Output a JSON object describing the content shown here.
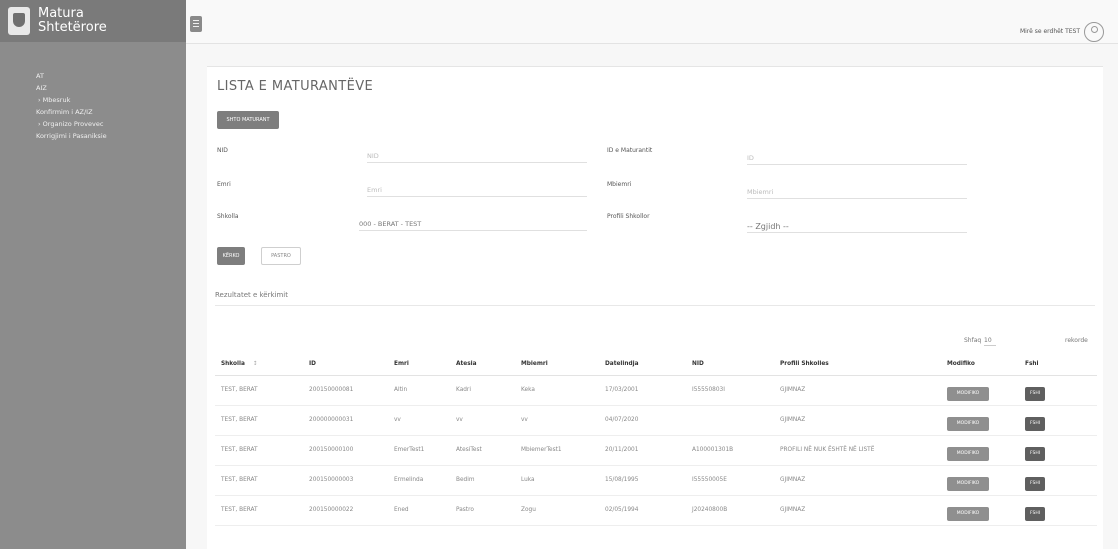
{
  "app": {
    "brand_line1": "Matura",
    "brand_line2": "Shtetërore"
  },
  "sidebar": {
    "items": [
      {
        "label": "AT"
      },
      {
        "label": "AIZ"
      },
      {
        "label": "› Mbesruk"
      },
      {
        "label": "Konfirmim i AZ/IZ"
      },
      {
        "label": "› Organizo Provevec"
      },
      {
        "label": "Korrigjimi i Pasaniksie"
      }
    ]
  },
  "topbar": {
    "welcome": "Mirë se erdhët TEST"
  },
  "page": {
    "title": "LISTA E MATURANTËVE",
    "add_button": "SHTO MATURANT"
  },
  "form": {
    "nid_label": "NID",
    "nid_placeholder": "NID",
    "id_label": "ID e Maturantit",
    "id_placeholder": "ID",
    "emri_label": "Emri",
    "emri_placeholder": "Emri",
    "mbiemri_label": "Mbiemri",
    "mbiemri_placeholder": "Mbiemri",
    "shkolla_label": "Shkolla",
    "shkolla_value": "000 - BERAT - TEST",
    "profili_label": "Profili Shkollor",
    "profili_value": "-- Zgjidh --",
    "search_button": "KËRKO",
    "clear_button": "PASTRO"
  },
  "results": {
    "title": "Rezultatet e kërkimit",
    "show_label": "Shfaq",
    "show_value": "10",
    "records_label": "rekorde",
    "columns": [
      "Shkolla",
      "ID",
      "Emri",
      "Atesia",
      "Mbiemri",
      "Datelindja",
      "NID",
      "Profili Shkolles",
      "Modifiko",
      "Fshi"
    ],
    "modify_label": "MODIFIKO",
    "delete_label": "FSHI",
    "rows": [
      {
        "shkolla": "TEST, BERAT",
        "id": "200150000081",
        "emri": "Altin",
        "atesia": "Kadri",
        "mbiemri": "Keka",
        "datelindja": "17/03/2001",
        "nid": "I55550803I",
        "profili": "GJIMNAZ"
      },
      {
        "shkolla": "TEST, BERAT",
        "id": "200000000031",
        "emri": "vv",
        "atesia": "vv",
        "mbiemri": "vv",
        "datelindja": "04/07/2020",
        "nid": "",
        "profili": "GJIMNAZ"
      },
      {
        "shkolla": "TEST, BERAT",
        "id": "200150000100",
        "emri": "EmerTest1",
        "atesia": "AtesiTest",
        "mbiemri": "MbiemerTest1",
        "datelindja": "20/11/2001",
        "nid": "A100001301B",
        "profili": "PROFILI NË NUK ËSHTË NË LISTË"
      },
      {
        "shkolla": "TEST, BERAT",
        "id": "200150000003",
        "emri": "Ermelinda",
        "atesia": "Bedim",
        "mbiemri": "Luka",
        "datelindja": "15/08/1995",
        "nid": "I55550005E",
        "profili": "GJIMNAZ"
      },
      {
        "shkolla": "TEST, BERAT",
        "id": "200150000022",
        "emri": "Ened",
        "atesia": "Pastro",
        "mbiemri": "Zogu",
        "datelindja": "02/05/1994",
        "nid": "J20240800B",
        "profili": "GJIMNAZ"
      }
    ]
  },
  "colors": {
    "sidebar": "#8c8c8c",
    "button": "#7e7e7e",
    "delete_button": "#5f5f5f"
  }
}
